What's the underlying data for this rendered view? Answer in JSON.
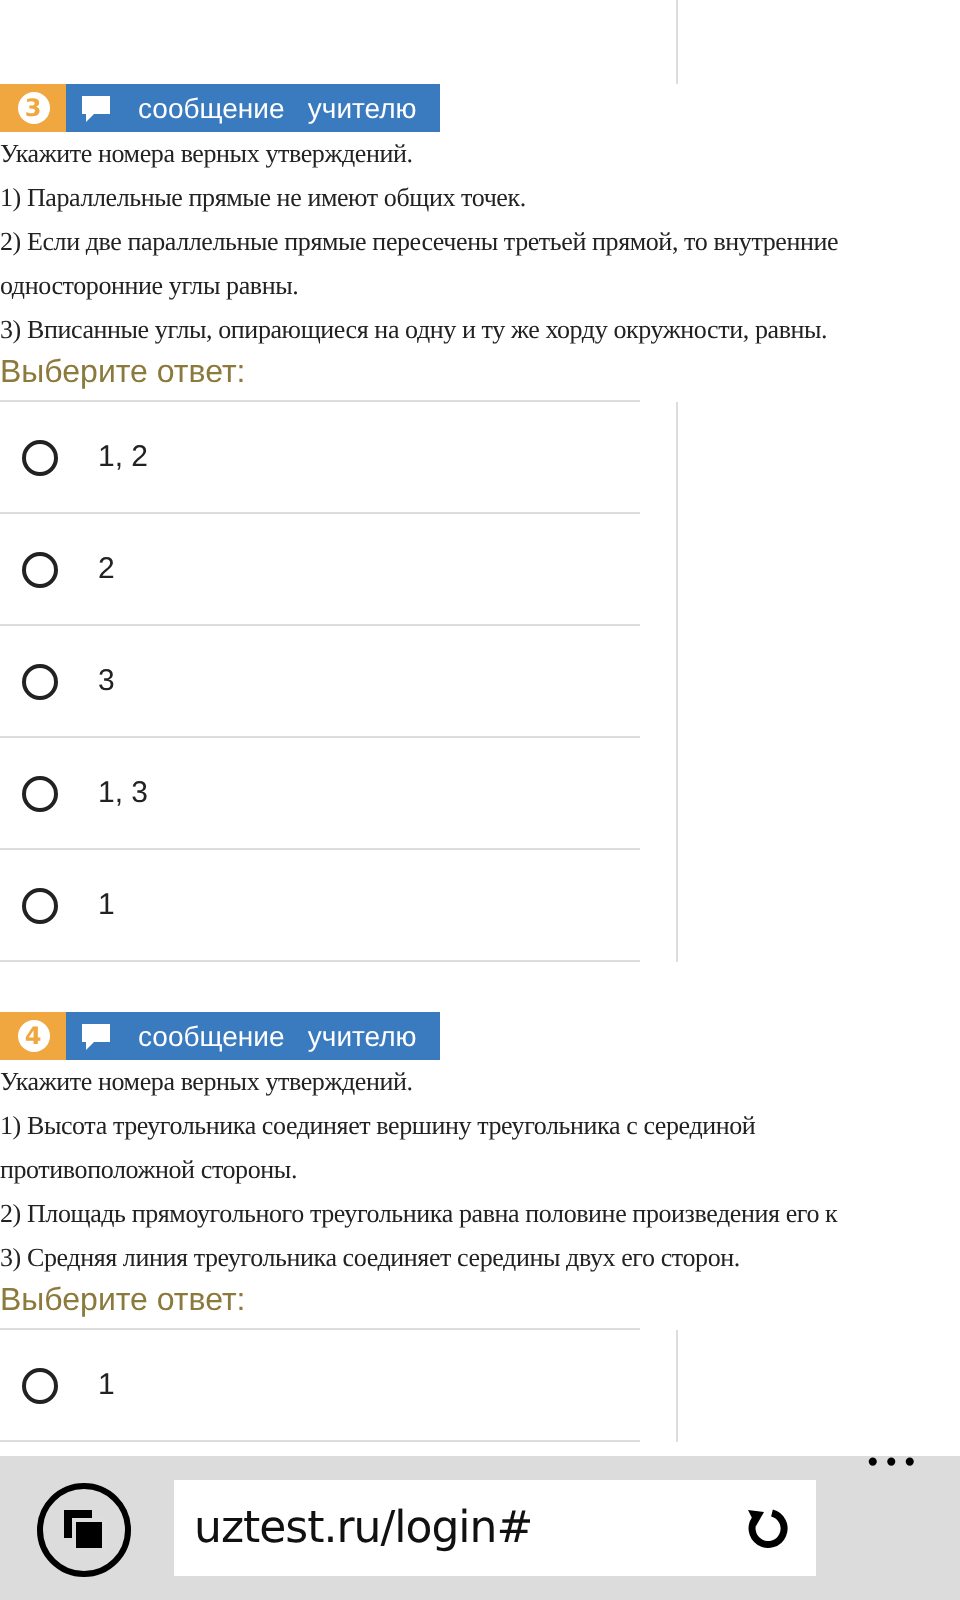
{
  "questions": [
    {
      "number": "3",
      "message_button": "сообщение   учителю",
      "lines": [
        "Укажите номера верных утверждений.",
        "1) Параллельные прямые не имеют общих точек.",
        "2) Если две параллельные прямые пересечены третьей прямой, то внутренние",
        "односторонние углы равны.",
        "3) Вписанные углы, опирающиеся на одну и ту же хорду окружности, равны."
      ],
      "prompt": "Выберите ответ:",
      "options": [
        {
          "label": "1, 2",
          "selected": false
        },
        {
          "label": "2",
          "selected": false
        },
        {
          "label": "3",
          "selected": false
        },
        {
          "label": "1, 3",
          "selected": false
        },
        {
          "label": "1",
          "selected": false
        }
      ]
    },
    {
      "number": "4",
      "message_button": "сообщение   учителю",
      "lines": [
        "Укажите номера верных утверждений.",
        "1) Высота треугольника соединяет вершину треугольника с серединой",
        "противоположной стороны.",
        "2) Площадь прямоугольного треугольника равна половине произведения его к",
        "3) Средняя линия треугольника соединяет середины двух его сторон."
      ],
      "prompt": "Выберите ответ:",
      "options": [
        {
          "label": "1",
          "selected": false
        }
      ]
    }
  ],
  "browser": {
    "url": "uztest.ru/login#",
    "more": "•••"
  }
}
